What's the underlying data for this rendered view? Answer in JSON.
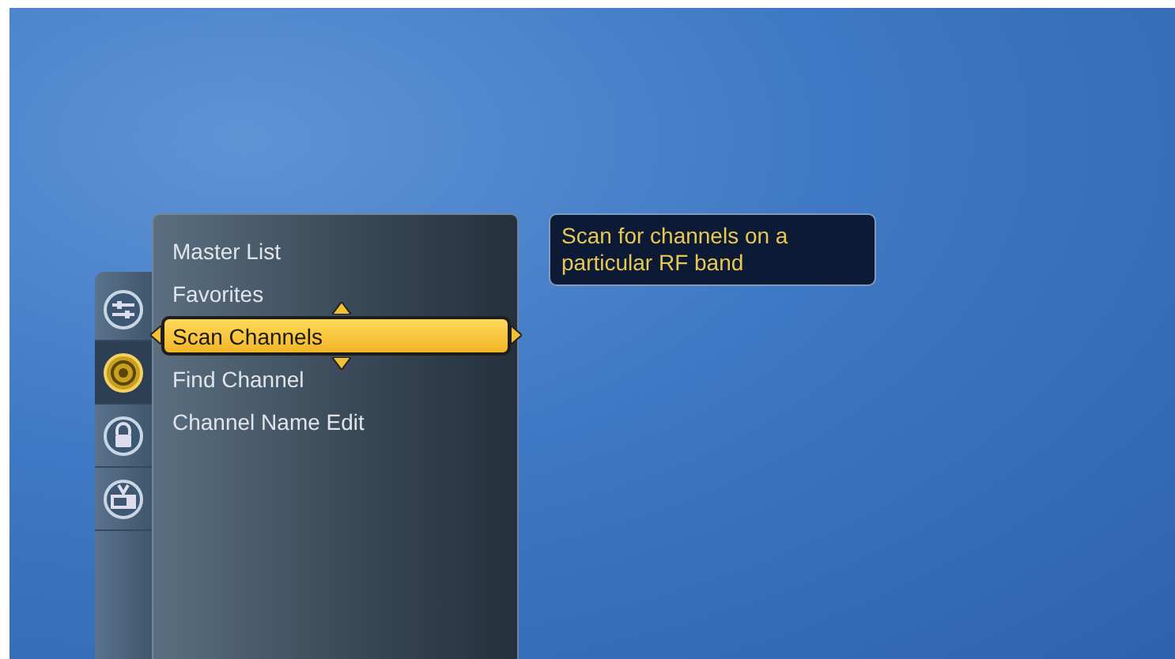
{
  "side_tabs": [
    {
      "kind": "settings",
      "selected": false
    },
    {
      "kind": "signal",
      "selected": true
    },
    {
      "kind": "lock",
      "selected": false
    },
    {
      "kind": "tv",
      "selected": false
    }
  ],
  "menu": {
    "items": [
      {
        "label": "Master List",
        "selected": false
      },
      {
        "label": "Favorites",
        "selected": false
      },
      {
        "label": "Scan Channels",
        "selected": true
      },
      {
        "label": "Find Channel",
        "selected": false
      },
      {
        "label": "Channel Name Edit",
        "selected": false
      }
    ]
  },
  "tooltip": {
    "text": "Scan for channels on a particular RF band"
  }
}
